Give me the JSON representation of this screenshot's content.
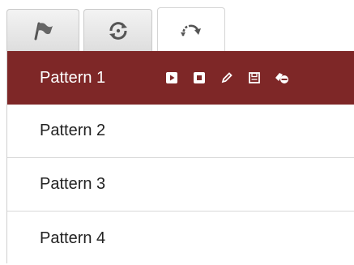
{
  "tabs": [
    {
      "icon": "preset-flag-icon",
      "active": false
    },
    {
      "icon": "patrol-cycle-icon",
      "active": false
    },
    {
      "icon": "pattern-rotate-icon",
      "active": true
    }
  ],
  "patterns": [
    {
      "label": "Pattern 1",
      "selected": true
    },
    {
      "label": "Pattern 2",
      "selected": false
    },
    {
      "label": "Pattern 3",
      "selected": false
    },
    {
      "label": "Pattern 4",
      "selected": false
    }
  ],
  "row_tools": [
    {
      "icon": "play-icon"
    },
    {
      "icon": "stop-icon"
    },
    {
      "icon": "edit-pencil-icon"
    },
    {
      "icon": "save-icon"
    },
    {
      "icon": "delete-icon"
    }
  ],
  "colors": {
    "selected_row": "#7e2727",
    "text": "#222222"
  }
}
